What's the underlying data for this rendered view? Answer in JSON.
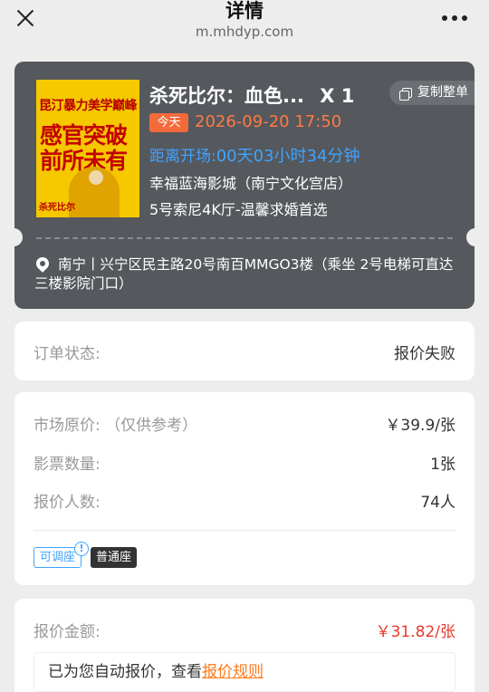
{
  "header": {
    "title": "详情",
    "domain": "m.mhdyp.com"
  },
  "ticket": {
    "poster_lines": [
      "昆汀暴力美学巅峰",
      "感官突破",
      "前所未有",
      "杀死比尔"
    ],
    "movie_name": "杀死比尔：血色...",
    "quantity": "X 1",
    "copy_label": "复制整单",
    "today_badge": "今天",
    "showtime": "2026-09-20 17:50",
    "countdown_prefix": "距离开场:",
    "countdown_value": "00天03小时34分钟",
    "cinema": "幸福蓝海影城（南宁文化宫店）",
    "hall": "5号索尼4K厅-温馨求婚首选",
    "address": "南宁丨兴宁区民主路20号南百MMGO3楼（乘坐 2号电梯可直达三楼影院门口）"
  },
  "status": {
    "label": "订单状态:",
    "value": "报价失败"
  },
  "info": {
    "market_price_label": "市场原价: （仅供参考）",
    "market_price_value": "￥39.9/张",
    "ticket_count_label": "影票数量:",
    "ticket_count_value": "1张",
    "bidders_label": "报价人数:",
    "bidders_value": "74人",
    "tag_adjustable": "可调座",
    "tag_info": "!",
    "tag_seat": "普通座"
  },
  "price": {
    "label": "报价金额:",
    "value": "￥31.82/张",
    "notice_text": "已为您自动报价，查看",
    "notice_link": "报价规则"
  },
  "colors": {
    "accent_orange": "#ff7a45",
    "accent_blue": "#3fa3ff",
    "price_red": "#e63a2e",
    "card_dark": "#55585d"
  }
}
